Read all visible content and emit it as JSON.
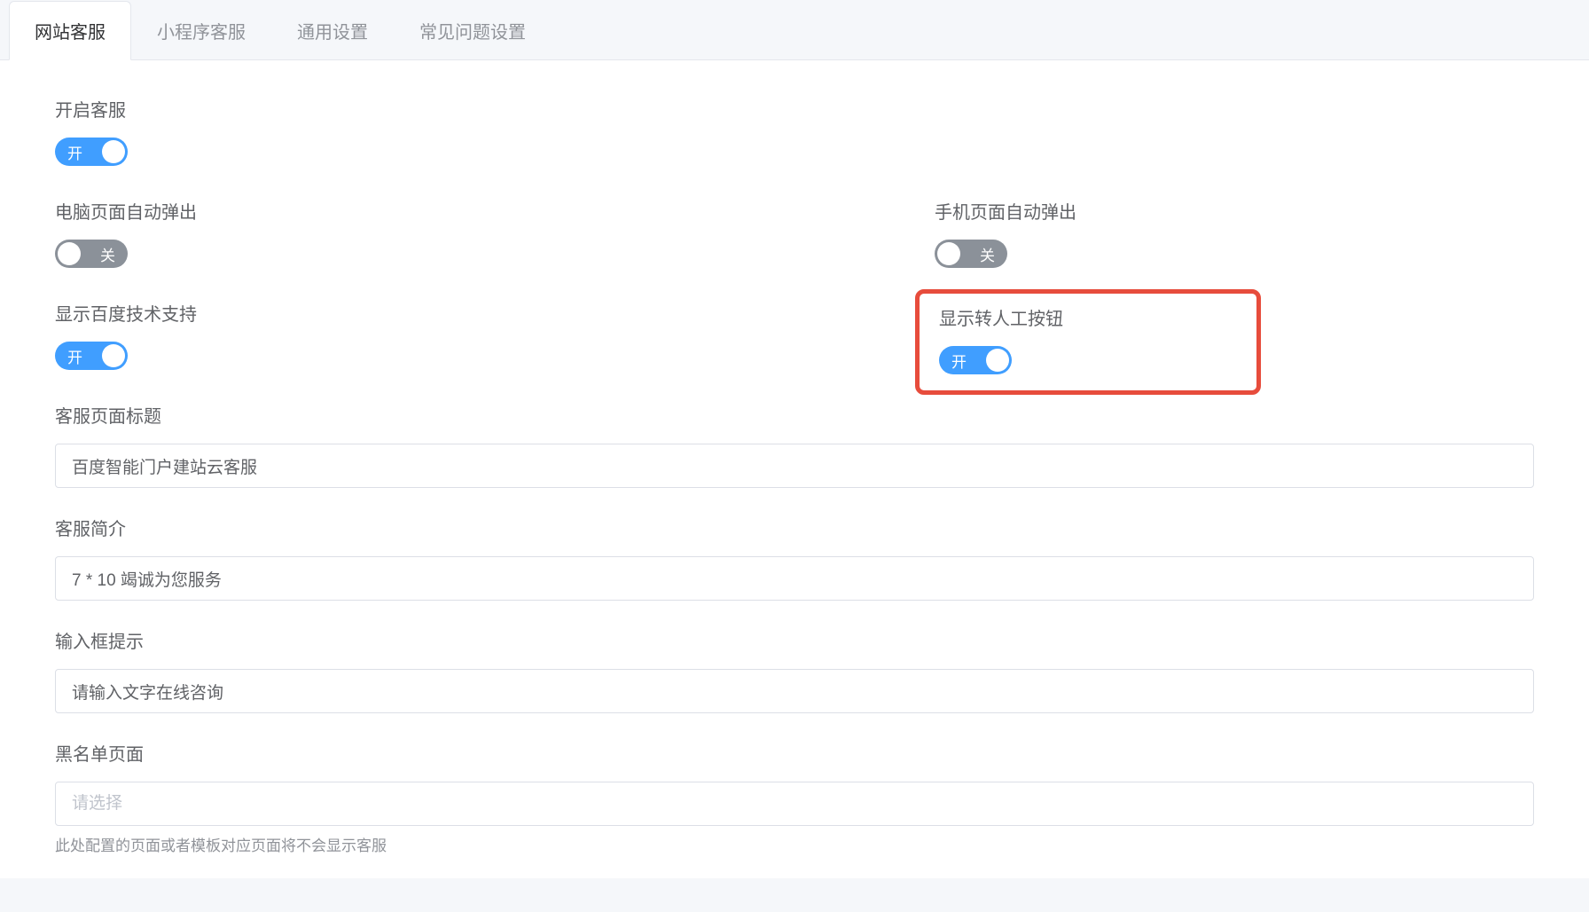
{
  "tabs": [
    {
      "label": "网站客服",
      "active": true
    },
    {
      "label": "小程序客服",
      "active": false
    },
    {
      "label": "通用设置",
      "active": false
    },
    {
      "label": "常见问题设置",
      "active": false
    }
  ],
  "switches": {
    "on_label": "开",
    "off_label": "关"
  },
  "fields": {
    "enable_service": {
      "label": "开启客服",
      "state": "on"
    },
    "desktop_popup": {
      "label": "电脑页面自动弹出",
      "state": "off"
    },
    "mobile_popup": {
      "label": "手机页面自动弹出",
      "state": "off"
    },
    "show_baidu_support": {
      "label": "显示百度技术支持",
      "state": "on"
    },
    "show_human_button": {
      "label": "显示转人工按钮",
      "state": "on"
    },
    "page_title": {
      "label": "客服页面标题",
      "value": "百度智能门户建站云客服"
    },
    "intro": {
      "label": "客服简介",
      "value": "7 * 10 竭诚为您服务"
    },
    "placeholder_hint": {
      "label": "输入框提示",
      "value": "请输入文字在线咨询"
    },
    "blacklist": {
      "label": "黑名单页面",
      "placeholder": "请选择",
      "help": "此处配置的页面或者模板对应页面将不会显示客服"
    }
  }
}
